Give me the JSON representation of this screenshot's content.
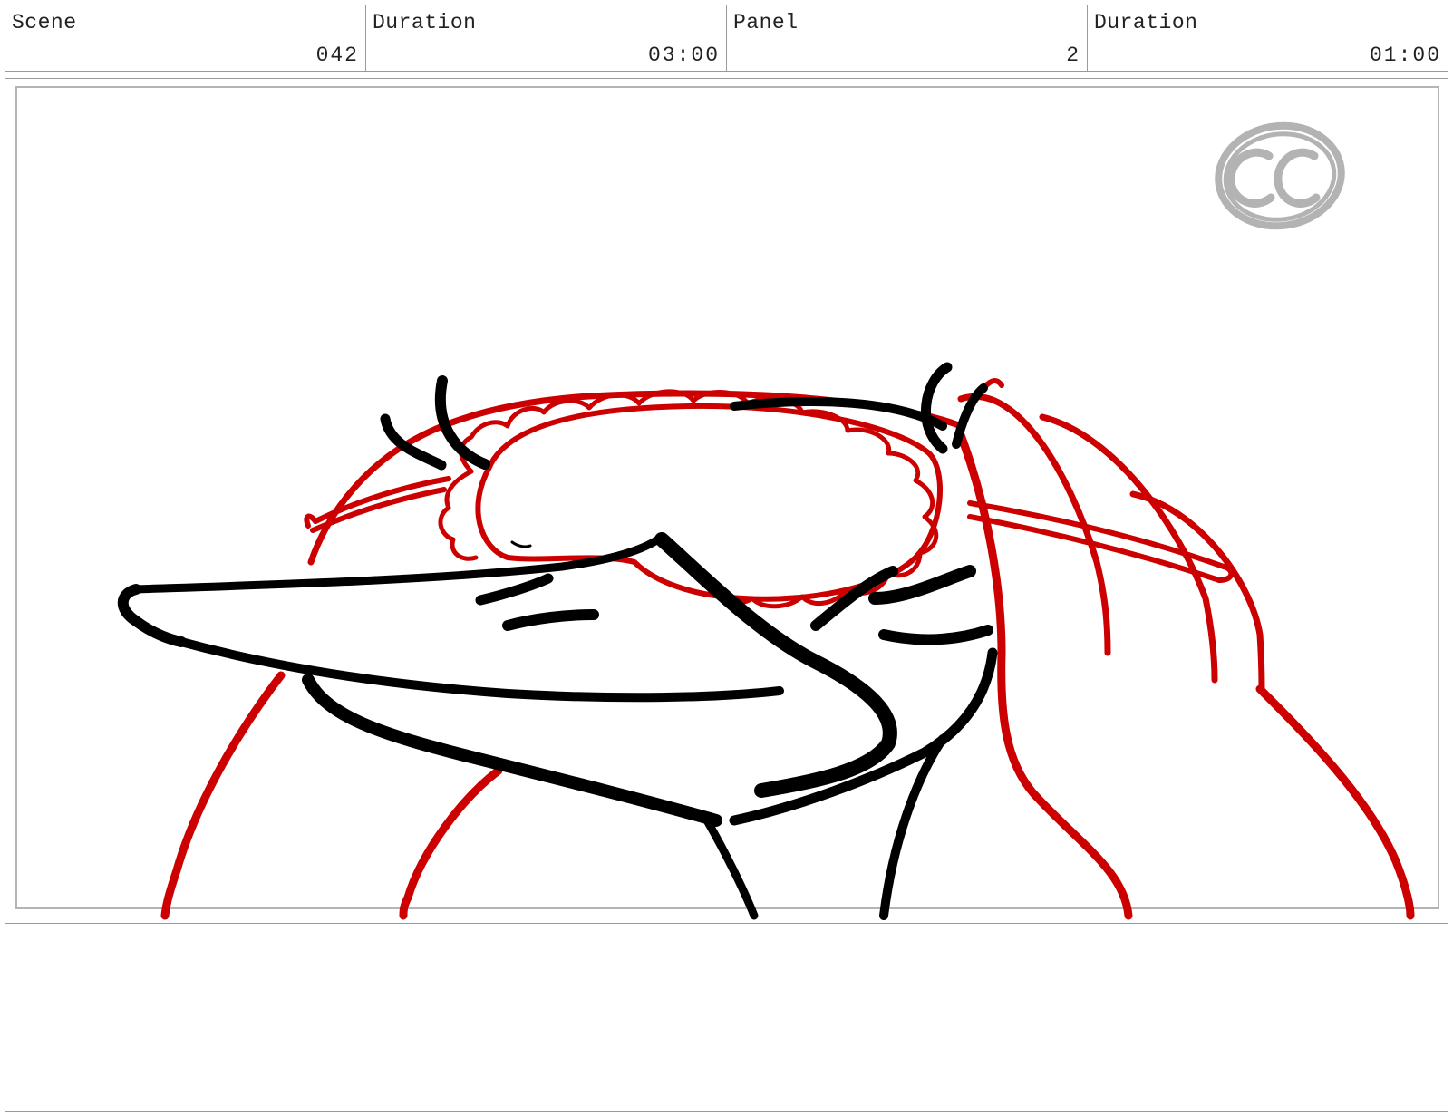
{
  "header": {
    "scene": {
      "label": "Scene",
      "value": "042"
    },
    "scene_duration": {
      "label": "Duration",
      "value": "03:00"
    },
    "panel": {
      "label": "Panel",
      "value": "2"
    },
    "panel_duration": {
      "label": "Duration",
      "value": "01:00"
    }
  },
  "panel_image": {
    "watermark_logo": "CC",
    "colors": {
      "ink": "#000000",
      "red_pencil": "#cc0000",
      "watermark": "#b3b3b3"
    }
  },
  "notes": {
    "text": ""
  }
}
